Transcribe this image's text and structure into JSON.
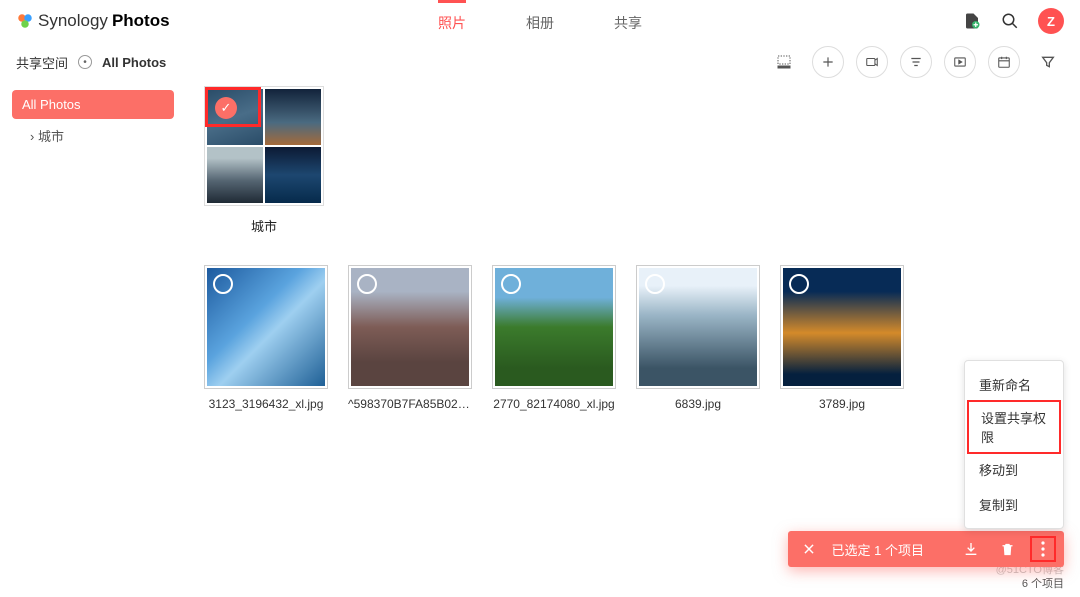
{
  "app": {
    "name1": "Synology",
    "name2": "Photos",
    "avatar_initial": "Z"
  },
  "nav": {
    "tabs": [
      "照片",
      "相册",
      "共享"
    ],
    "active_index": 0
  },
  "breadcrumb": {
    "root": "共享空间",
    "current": "All Photos"
  },
  "sidebar": {
    "items": [
      {
        "label": "All Photos"
      },
      {
        "label": "城市"
      }
    ],
    "active_index": 0
  },
  "albums": [
    {
      "name": "城市",
      "selected": true
    }
  ],
  "photos": [
    {
      "filename": "3123_3196432_xl.jpg"
    },
    {
      "filename": "^598370B7FA85B02A310..."
    },
    {
      "filename": "2770_82174080_xl.jpg"
    },
    {
      "filename": "6839.jpg"
    },
    {
      "filename": "3789.jpg"
    }
  ],
  "context_menu": {
    "items": [
      "重新命名",
      "设置共享权限",
      "移动到",
      "复制到"
    ],
    "highlight_index": 1
  },
  "selection_bar": {
    "text": "已选定 1 个项目"
  },
  "footer": {
    "count": "6 个项目"
  },
  "watermark": "@51CTO博客"
}
